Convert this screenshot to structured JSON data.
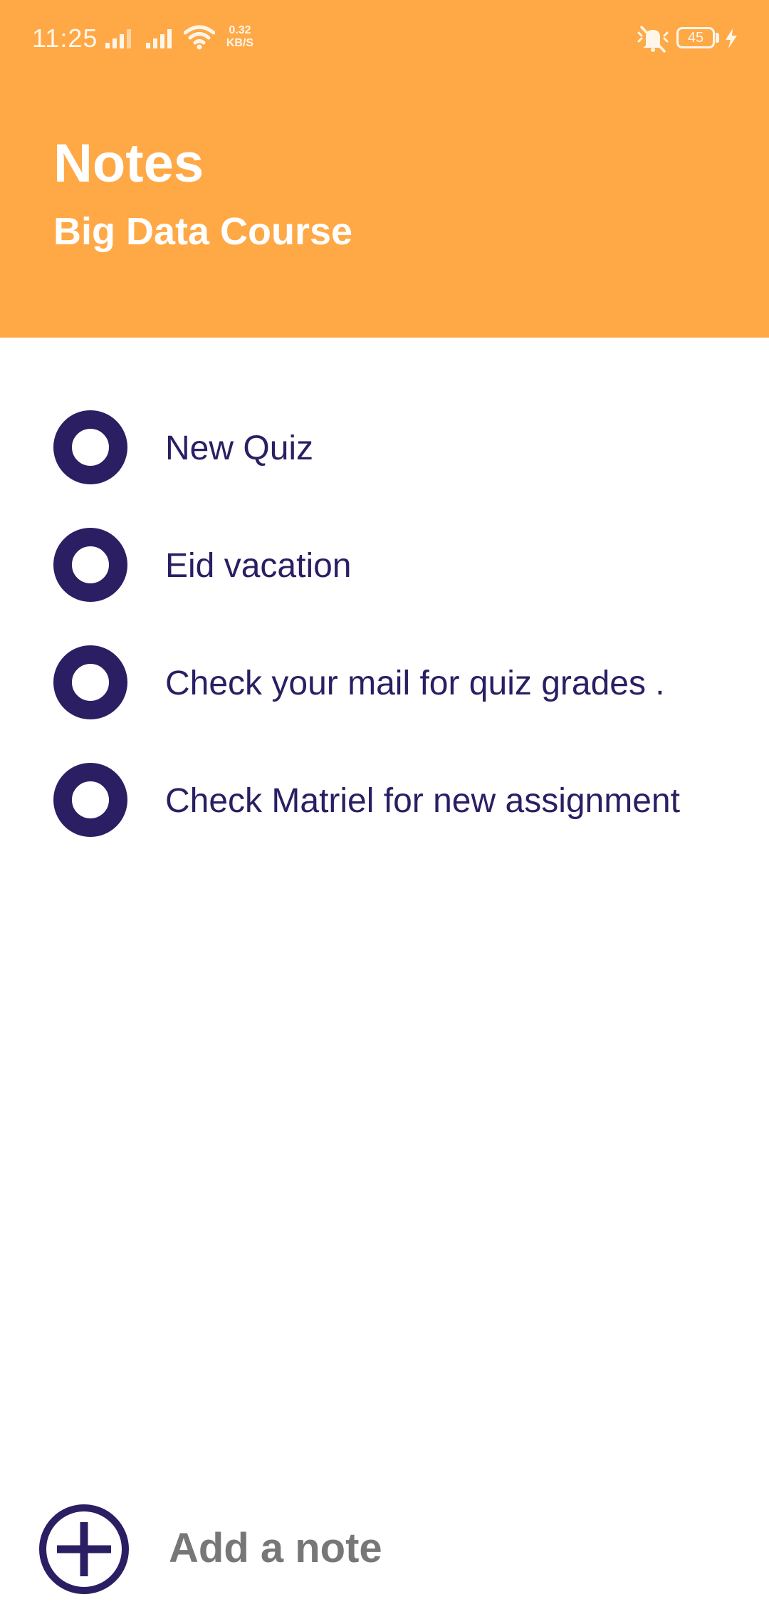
{
  "status_bar": {
    "time": "11:25",
    "net_speed_value": "0.32",
    "net_speed_unit": "KB/S",
    "battery": "45"
  },
  "header": {
    "title": "Notes",
    "subtitle": "Big Data Course",
    "background_color": "#ffa846"
  },
  "notes": [
    {
      "text": "New Quiz"
    },
    {
      "text": "Eid vacation"
    },
    {
      "text": "Check your mail for quiz grades ."
    },
    {
      "text": "Check Matriel for new assignment"
    }
  ],
  "add_note": {
    "label": "Add a note",
    "icon": "add-circle-icon"
  },
  "colors": {
    "accent": "#2b1e63",
    "header": "#ffa846",
    "add_label": "#777777"
  }
}
